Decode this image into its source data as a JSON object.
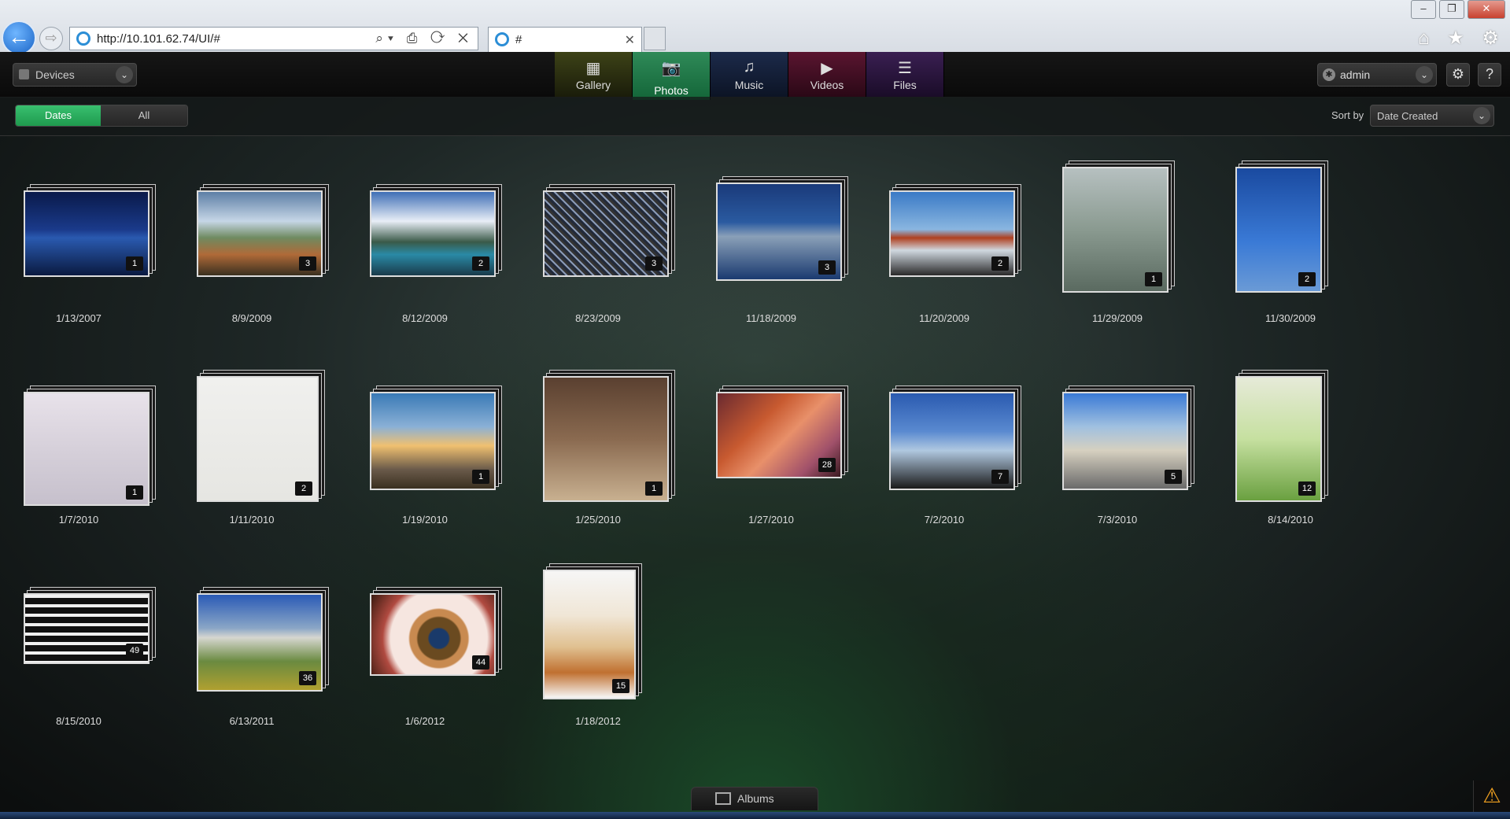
{
  "browser": {
    "url": "http://10.101.62.74/UI/#",
    "tab_title": "#",
    "forward_glyph": "⇨",
    "back_glyph": "←",
    "close_glyph": "✕",
    "address_tools": "⌕▾ ⎙ ⟳ ✕",
    "right_icons": "⌂ ★ ⚙",
    "window_controls": [
      "–",
      "❐",
      "✕"
    ]
  },
  "header": {
    "devices_label": "Devices",
    "chevron": "⌄",
    "tabs": [
      {
        "label": "Gallery",
        "icon": "▦"
      },
      {
        "label": "Photos",
        "icon": "📷"
      },
      {
        "label": "Music",
        "icon": "♫"
      },
      {
        "label": "Videos",
        "icon": "▶"
      },
      {
        "label": "Files",
        "icon": "☰"
      }
    ],
    "user": "admin",
    "settings_icon": "⚙",
    "help_icon": "?",
    "user_icon": "✱"
  },
  "toolbar": {
    "segments": [
      "Dates",
      "All"
    ],
    "sort_label": "Sort by",
    "sort_value": "Date Created"
  },
  "albums": [
    {
      "date": "1/13/2007",
      "count": "1"
    },
    {
      "date": "8/9/2009",
      "count": "3"
    },
    {
      "date": "8/12/2009",
      "count": "2"
    },
    {
      "date": "8/23/2009",
      "count": "3"
    },
    {
      "date": "11/18/2009",
      "count": "3"
    },
    {
      "date": "11/20/2009",
      "count": "2"
    },
    {
      "date": "11/29/2009",
      "count": "1"
    },
    {
      "date": "11/30/2009",
      "count": "2"
    },
    {
      "date": "1/7/2010",
      "count": "1"
    },
    {
      "date": "1/11/2010",
      "count": "2"
    },
    {
      "date": "1/19/2010",
      "count": "1"
    },
    {
      "date": "1/25/2010",
      "count": "1"
    },
    {
      "date": "1/27/2010",
      "count": "28"
    },
    {
      "date": "7/2/2010",
      "count": "7"
    },
    {
      "date": "7/3/2010",
      "count": "5"
    },
    {
      "date": "8/14/2010",
      "count": "12"
    },
    {
      "date": "8/15/2010",
      "count": "49"
    },
    {
      "date": "6/13/2011",
      "count": "36"
    },
    {
      "date": "1/6/2012",
      "count": "44"
    },
    {
      "date": "1/18/2012",
      "count": "15"
    }
  ],
  "footer": {
    "albums_label": "Albums",
    "alert_icon": "⚠"
  },
  "colors": {
    "accent_green": "#1f9a4e",
    "background": "#111111"
  }
}
